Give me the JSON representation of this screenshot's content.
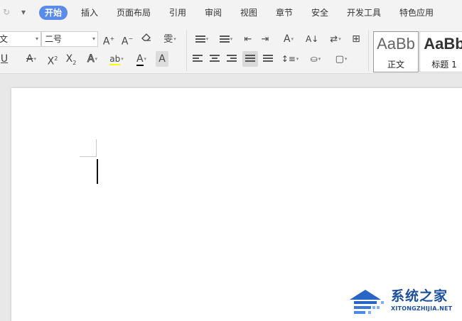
{
  "menu": {
    "tabs": [
      {
        "label": "开始",
        "active": true
      },
      {
        "label": "插入"
      },
      {
        "label": "页面布局"
      },
      {
        "label": "引用"
      },
      {
        "label": "审阅"
      },
      {
        "label": "视图"
      },
      {
        "label": "章节"
      },
      {
        "label": "安全"
      },
      {
        "label": "开发工具"
      },
      {
        "label": "特色应用"
      }
    ]
  },
  "ribbon": {
    "font_name": "文",
    "font_size": "二号",
    "styles": [
      {
        "preview": "AaBb",
        "label": "正文"
      },
      {
        "preview": "AaBb",
        "label": "标题 1"
      }
    ]
  },
  "colors": {
    "accent": "#5a8bea",
    "font_color": "#000000",
    "highlight": "#ffff00",
    "watermark": "#1e4f9c"
  },
  "watermark": {
    "title": "系统之家",
    "url": "XITONGZHIJIA.NET"
  }
}
